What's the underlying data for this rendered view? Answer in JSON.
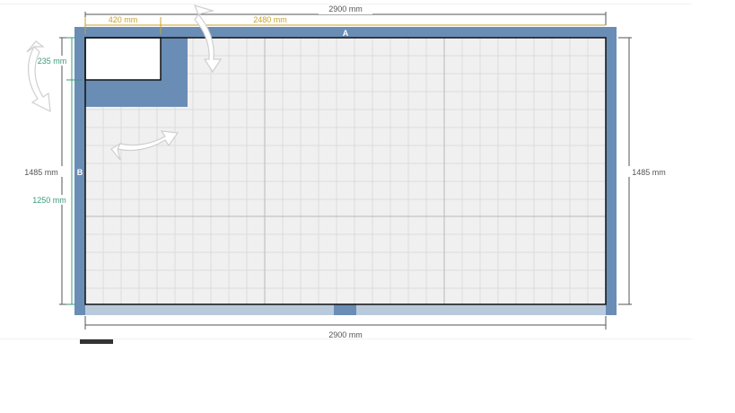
{
  "colors": {
    "wall": "#6a8db5",
    "wall_light": "#b9cadc",
    "floor": "#f0f0f0",
    "grid_minor": "#dcdcdc",
    "grid_major": "#b8b8b8",
    "dim_gray": "#555555",
    "dim_gold": "#c9a227",
    "dim_green": "#3a9a78",
    "rotate_arrow": "#d8d8d8"
  },
  "labels": {
    "wall_a": "A",
    "wall_b": "B"
  },
  "dimensions": {
    "top_total": "2900 mm",
    "top_segment_1": "420 mm",
    "top_segment_2": "2480 mm",
    "bottom_total": "2900 mm",
    "left_total": "1485 mm",
    "right_total": "1485 mm",
    "left_segment_1": "235 mm",
    "left_segment_2": "1250 mm"
  },
  "icons": {
    "rotate_top": "rotate-arrow-icon",
    "rotate_left": "rotate-arrow-icon",
    "rotate_center": "rotate-arrow-icon"
  }
}
